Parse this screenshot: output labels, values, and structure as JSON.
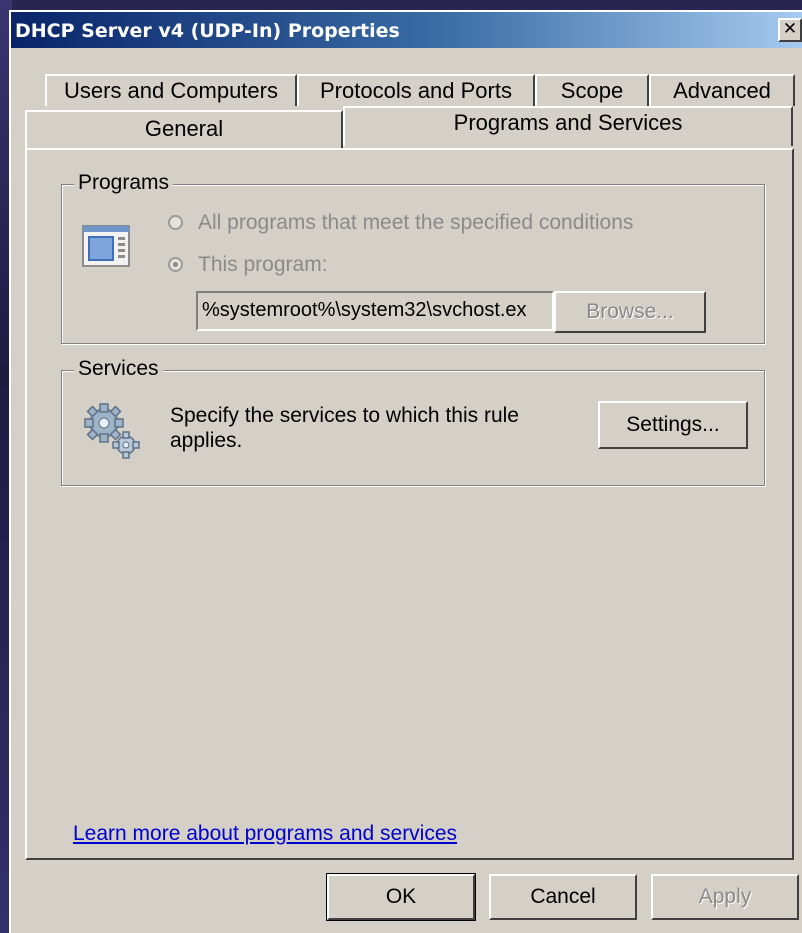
{
  "window": {
    "title": "DHCP Server v4 (UDP-In) Properties",
    "close_glyph": "✕"
  },
  "tabs": {
    "row_back": [
      "Users and Computers",
      "Protocols and Ports",
      "Scope",
      "Advanced"
    ],
    "row_front": [
      "General",
      "Programs and Services"
    ],
    "active": "Programs and Services"
  },
  "programs": {
    "group_label": "Programs",
    "option_all": "All programs that meet the specified conditions",
    "option_this": "This program:",
    "selected_option": "This program:",
    "path_value": "%systemroot%\\system32\\svchost.ex",
    "browse_label": "Browse..."
  },
  "services": {
    "group_label": "Services",
    "description": "Specify the services to which this rule applies.",
    "settings_label": "Settings..."
  },
  "learn_more_link": "Learn more about programs and services",
  "footer": {
    "ok_label": "OK",
    "cancel_label": "Cancel",
    "apply_label": "Apply"
  },
  "icons": {
    "program": "application-window-icon",
    "services": "gears-icon"
  },
  "colors": {
    "title_start": "#0a246a",
    "title_end": "#a6caf0",
    "dialog_face": "#d4d0c8",
    "link": "#0000cc",
    "disabled_text": "#8a8a8a"
  }
}
